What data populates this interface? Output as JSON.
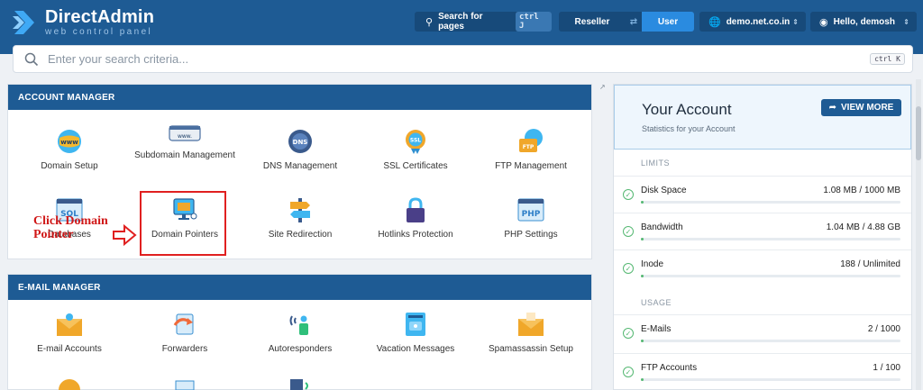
{
  "header": {
    "logo_title": "DirectAdmin",
    "logo_sub": "web control panel",
    "search_pages_label": "Search for pages",
    "search_pages_kbd": "ctrl J",
    "role_reseller": "Reseller",
    "role_user": "User",
    "domain": "demo.net.co.in",
    "greeting": "Hello, demosh",
    "brand_color": "#1e5b94"
  },
  "search": {
    "placeholder": "Enter your search criteria...",
    "kbd": "ctrl K"
  },
  "account_manager": {
    "title": "ACCOUNT MANAGER",
    "tiles": [
      {
        "label": "Domain Setup",
        "icon": "www-globe-icon"
      },
      {
        "label": "Subdomain Management",
        "icon": "subdomain-window-icon"
      },
      {
        "label": "DNS Management",
        "icon": "dns-globe-icon"
      },
      {
        "label": "SSL Certificates",
        "icon": "ssl-badge-icon"
      },
      {
        "label": "FTP Management",
        "icon": "ftp-folder-icon"
      },
      {
        "label": "Databases",
        "icon": "sql-database-icon"
      },
      {
        "label": "Domain Pointers",
        "icon": "domain-pointer-monitor-icon"
      },
      {
        "label": "Site Redirection",
        "icon": "signpost-icon"
      },
      {
        "label": "Hotlinks Protection",
        "icon": "padlock-icon"
      },
      {
        "label": "PHP Settings",
        "icon": "php-window-icon"
      }
    ]
  },
  "annotation": {
    "text": "Click Domain Pointer",
    "color": "#e02020"
  },
  "email_manager": {
    "title": "E-MAIL MANAGER",
    "tiles": [
      {
        "label": "E-mail Accounts",
        "icon": "envelope-user-icon"
      },
      {
        "label": "Forwarders",
        "icon": "forward-icon"
      },
      {
        "label": "Autoresponders",
        "icon": "autoresponder-icon"
      },
      {
        "label": "Vacation Messages",
        "icon": "vacation-board-icon"
      },
      {
        "label": "Spamassassin Setup",
        "icon": "spam-envelope-icon"
      }
    ]
  },
  "account": {
    "title": "Your Account",
    "subtitle": "Statistics for your Account",
    "view_more": "VIEW MORE",
    "limits_label": "LIMITS",
    "usage_label": "USAGE",
    "limits": [
      {
        "name": "Disk Space",
        "value": "1.08 MB / 1000 MB",
        "fraction": 0.01
      },
      {
        "name": "Bandwidth",
        "value": "1.04 MB / 4.88 GB",
        "fraction": 0.01
      },
      {
        "name": "Inode",
        "value": "188 / Unlimited",
        "fraction": 0.01
      }
    ],
    "usage": [
      {
        "name": "E-Mails",
        "value": "2 / 1000",
        "fraction": 0.01
      },
      {
        "name": "FTP Accounts",
        "value": "1 / 100",
        "fraction": 0.01
      }
    ],
    "ok_color": "#55b872"
  }
}
